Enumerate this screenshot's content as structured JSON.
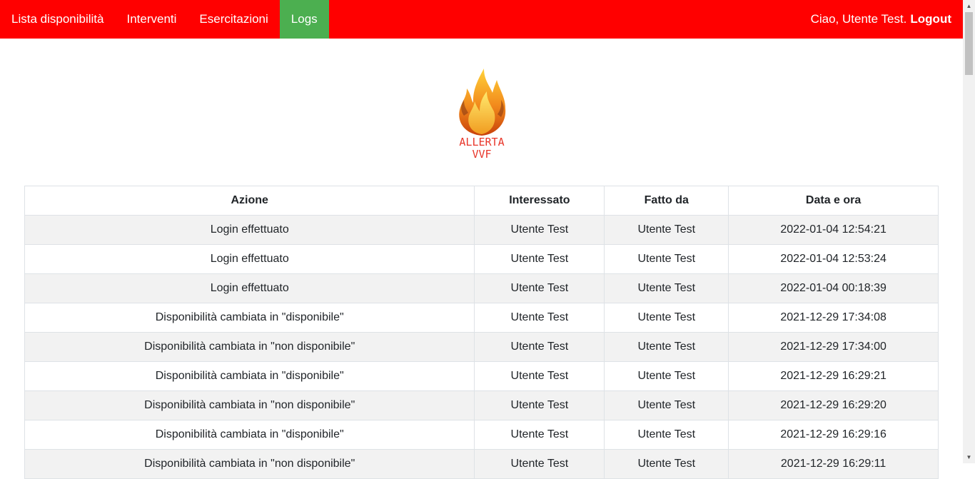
{
  "nav": {
    "items": [
      {
        "label": "Lista disponibilità",
        "active": false
      },
      {
        "label": "Interventi",
        "active": false
      },
      {
        "label": "Esercitazioni",
        "active": false
      },
      {
        "label": "Logs",
        "active": true
      }
    ],
    "greeting": "Ciao, Utente Test.",
    "logout_label": "Logout"
  },
  "logo": {
    "line1": "ALLERTA",
    "line2": "VVF"
  },
  "colors": {
    "navbar": "#ff0000",
    "active_tab": "#4caf50",
    "logo_text": "#e8362a"
  },
  "table": {
    "headers": [
      "Azione",
      "Interessato",
      "Fatto da",
      "Data e ora"
    ],
    "rows": [
      [
        "Login effettuato",
        "Utente Test",
        "Utente Test",
        "2022-01-04 12:54:21"
      ],
      [
        "Login effettuato",
        "Utente Test",
        "Utente Test",
        "2022-01-04 12:53:24"
      ],
      [
        "Login effettuato",
        "Utente Test",
        "Utente Test",
        "2022-01-04 00:18:39"
      ],
      [
        "Disponibilità cambiata in \"disponibile\"",
        "Utente Test",
        "Utente Test",
        "2021-12-29 17:34:08"
      ],
      [
        "Disponibilità cambiata in \"non disponibile\"",
        "Utente Test",
        "Utente Test",
        "2021-12-29 17:34:00"
      ],
      [
        "Disponibilità cambiata in \"disponibile\"",
        "Utente Test",
        "Utente Test",
        "2021-12-29 16:29:21"
      ],
      [
        "Disponibilità cambiata in \"non disponibile\"",
        "Utente Test",
        "Utente Test",
        "2021-12-29 16:29:20"
      ],
      [
        "Disponibilità cambiata in \"disponibile\"",
        "Utente Test",
        "Utente Test",
        "2021-12-29 16:29:16"
      ],
      [
        "Disponibilità cambiata in \"non disponibile\"",
        "Utente Test",
        "Utente Test",
        "2021-12-29 16:29:11"
      ]
    ]
  }
}
